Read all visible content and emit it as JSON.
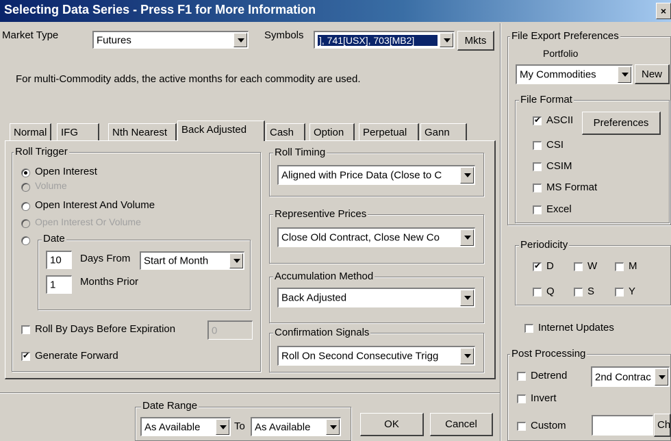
{
  "window": {
    "title": "Selecting Data Series - Press F1 for More Information",
    "close": "×"
  },
  "market": {
    "label": "Market Type",
    "value": "Futures"
  },
  "symbols": {
    "label": "Symbols",
    "value": "], 741[USX], 703[MB2]",
    "mkts_button": "Mkts"
  },
  "info_text": "For multi-Commodity adds, the active months for each commodity are used.",
  "tabs": [
    "Normal",
    "IFG",
    "Nth Nearest",
    "Back Adjusted",
    "Cash",
    "Option",
    "Perpetual",
    "Gann"
  ],
  "roll_trigger": {
    "title": "Roll Trigger",
    "options": [
      "Open Interest",
      "Volume",
      "Open Interest And Volume",
      "Open Interest Or Volume"
    ],
    "date": {
      "title": "Date",
      "days_value": "10",
      "days_label": "Days From",
      "from_value": "Start of Month",
      "months_value": "1",
      "months_label": "Months Prior"
    },
    "roll_by_days_label": "Roll By Days Before Expiration",
    "roll_by_days_value": "0",
    "generate_forward_label": "Generate Forward"
  },
  "roll_timing": {
    "title": "Roll Timing",
    "value": "Aligned with Price Data (Close to C"
  },
  "representive_prices": {
    "title": "Representive Prices",
    "value": "Close Old Contract, Close New Co"
  },
  "accumulation": {
    "title": "Accumulation Method",
    "value": "Back Adjusted"
  },
  "confirmation": {
    "title": "Confirmation Signals",
    "value": "Roll On Second Consecutive Trigg"
  },
  "date_range": {
    "title": "Date Range",
    "from": "As Available",
    "to_label": "To",
    "to": "As Available"
  },
  "buttons": {
    "ok": "OK",
    "cancel": "Cancel"
  },
  "export": {
    "title": "File Export Preferences",
    "portfolio_label": "Portfolio",
    "portfolio_value": "My Commodities",
    "new_button": "New",
    "file_format_title": "File Format",
    "formats": [
      "ASCII",
      "CSI",
      "CSIM",
      "MS Format",
      "Excel"
    ],
    "preferences_button": "Preferences",
    "periodicity_title": "Periodicity",
    "periods": [
      "D",
      "W",
      "M",
      "Q",
      "S",
      "Y"
    ],
    "internet_updates_label": "Internet Updates",
    "post_processing_title": "Post Processing",
    "detrend_label": "Detrend",
    "detrend_value": "2nd Contrac",
    "invert_label": "Invert",
    "custom_label": "Custom",
    "custom_value": "",
    "custom_button": "Ch"
  }
}
